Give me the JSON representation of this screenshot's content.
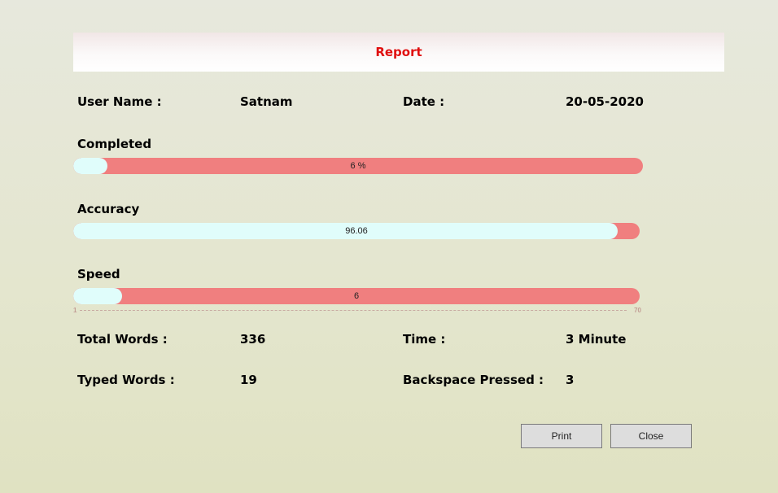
{
  "header": {
    "title": "Report"
  },
  "user": {
    "label": "User Name :",
    "value": "Satnam"
  },
  "date": {
    "label": "Date :",
    "value": "20-05-2020"
  },
  "completed": {
    "label": "Completed",
    "display": "6 %",
    "fraction": 0.06
  },
  "accuracy": {
    "label": "Accuracy",
    "display": "96.06",
    "fraction": 0.9606
  },
  "speed": {
    "label": "Speed",
    "display": "6",
    "fraction": 0.086,
    "scale_min": "1",
    "scale_max": "70"
  },
  "total_words": {
    "label": "Total Words :",
    "value": "336"
  },
  "time": {
    "label": "Time :",
    "value": "3 Minute"
  },
  "typed_words": {
    "label": "Typed Words :",
    "value": "19"
  },
  "backspace": {
    "label": "Backspace Pressed :",
    "value": "3"
  },
  "buttons": {
    "print": "Print",
    "close": "Close"
  },
  "colors": {
    "title": "#e01010",
    "bar_track": "#f07f7f",
    "bar_fill": "#e0fdfb"
  }
}
